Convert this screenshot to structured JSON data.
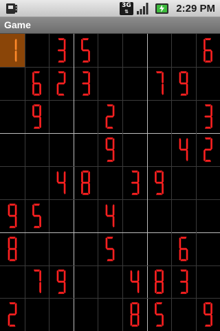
{
  "status_bar": {
    "time": "2:29 PM",
    "network_label": "3G",
    "icons": [
      "sim-card-icon",
      "network-3g-icon",
      "signal-strength-icon",
      "battery-charging-icon"
    ]
  },
  "app_bar": {
    "title": "Game"
  },
  "board": {
    "colors": {
      "digit": "#ff2020",
      "selected_cell": "#8a4508",
      "selected_digit": "#ff8a2a",
      "thin_line": "#3a3a3a",
      "thick_line": "#bdbdbd"
    },
    "selected": [
      0,
      0
    ],
    "grid": [
      [
        "1",
        "",
        "3",
        "5",
        "",
        "",
        "",
        "",
        "6"
      ],
      [
        "",
        "6",
        "2",
        "3",
        "",
        "",
        "7",
        "9",
        ""
      ],
      [
        "",
        "9",
        "",
        "",
        "2",
        "",
        "",
        "",
        "3"
      ],
      [
        "",
        "",
        "",
        "",
        "9",
        "",
        "",
        "4",
        "2"
      ],
      [
        "",
        "",
        "4",
        "8",
        "",
        "3",
        "9",
        "",
        ""
      ],
      [
        "9",
        "5",
        "",
        "",
        "4",
        "",
        "",
        "",
        ""
      ],
      [
        "8",
        "",
        "",
        "",
        "5",
        "",
        "",
        "6",
        ""
      ],
      [
        "",
        "7",
        "9",
        "",
        "",
        "4",
        "8",
        "3",
        ""
      ],
      [
        "2",
        "",
        "",
        "",
        "",
        "8",
        "5",
        "",
        "9"
      ]
    ]
  }
}
